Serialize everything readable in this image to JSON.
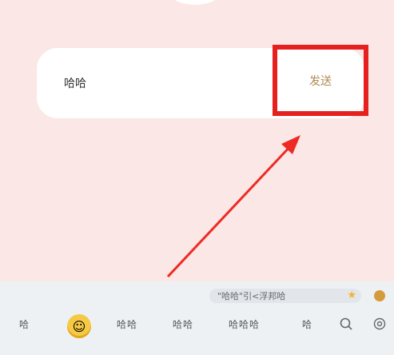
{
  "conversation": {
    "input_text": "哈哈",
    "send_label": "发送"
  },
  "keyboard": {
    "suggestion_text": "\"哈哈\"引<浮邦哈",
    "candidates": [
      "哈",
      "哈哈",
      "哈哈",
      "哈哈哈",
      "哈"
    ]
  },
  "colors": {
    "background": "#fbe7e5",
    "highlight": "#e5201e",
    "send_text": "#b08a50"
  },
  "icons": [
    "star-icon",
    "grin-emoji-icon",
    "search-icon",
    "settings-icon"
  ]
}
